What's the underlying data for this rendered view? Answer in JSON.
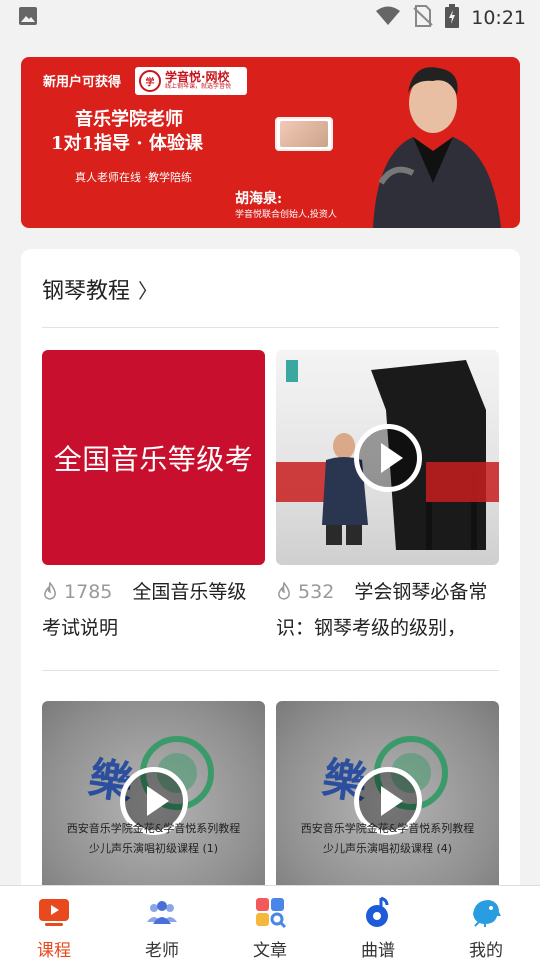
{
  "status_bar": {
    "time": "10:21",
    "icons": [
      "image-icon",
      "wifi-icon",
      "no-sim-icon",
      "battery-charging-icon"
    ]
  },
  "banner": {
    "new_user_text": "新用户可获得",
    "brand_name": "学音悦·网校",
    "brand_tagline": "线上钢琴课，就选学音悦",
    "title_line1": "音乐学院老师",
    "title_line2": "1对1指导 · 体验课",
    "subtitle": "真人老师在线 ·教学陪练",
    "host_name": "胡海泉:",
    "host_title": "学音悦联合创始人,投资人"
  },
  "section": {
    "title": "钢琴教程",
    "chevron": "〉"
  },
  "courses": [
    {
      "thumbnail_text": "全国音乐等级考",
      "views": "1785",
      "title": "全国音乐等级考试说明",
      "title_line1": "全国音乐等级",
      "title_line2": "考试说明"
    },
    {
      "thumbnail_text": "",
      "views": "532",
      "title": "学会钢琴必备常识：钢琴考级的级别，",
      "title_line1": "学会钢琴必备常",
      "title_line2": "识：钢琴考级的级别，"
    },
    {
      "thumbnail_line1": "西安音乐学院金花&学音悦系列教程",
      "thumbnail_line2": "少儿声乐演唱初级课程 (1)"
    },
    {
      "thumbnail_line1": "西安音乐学院金花&学音悦系列教程",
      "thumbnail_line2": "少儿声乐演唱初级课程 (4)"
    }
  ],
  "tabs": [
    {
      "label": "课程",
      "icon": "tv-icon",
      "active": true
    },
    {
      "label": "老师",
      "icon": "people-icon",
      "active": false
    },
    {
      "label": "文章",
      "icon": "grid-search-icon",
      "active": false
    },
    {
      "label": "曲谱",
      "icon": "music-note-icon",
      "active": false
    },
    {
      "label": "我的",
      "icon": "bird-icon",
      "active": false
    }
  ],
  "colors": {
    "accent": "#e8491d",
    "banner_red": "#d9201b",
    "thumb_red": "#c8102e"
  }
}
